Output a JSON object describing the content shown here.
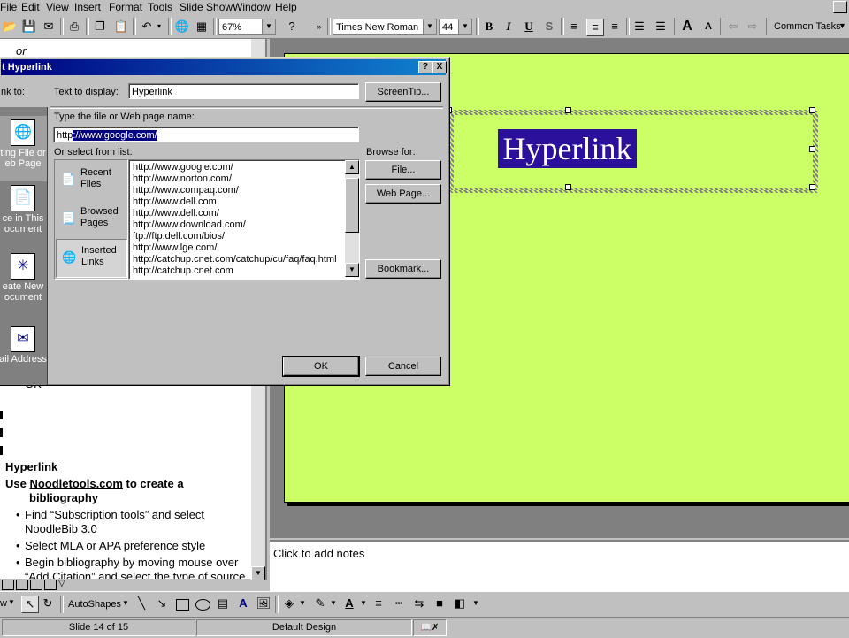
{
  "menubar": {
    "items": [
      "File",
      "Edit",
      "View",
      "Insert",
      "Format",
      "Tools",
      "Slide Show",
      "Window",
      "Help"
    ]
  },
  "toolbar": {
    "zoom": "67%",
    "font_name": "Times New Roman",
    "font_size": "44",
    "bold": "B",
    "italic": "I",
    "underline": "U",
    "shadow": "S",
    "common_tasks": "Common Tasks"
  },
  "outline": {
    "top_fragment": "or",
    "ok_fragment": "OK",
    "bullet_hyperlink": "Hyperlink",
    "bullet_use_prefix": "Use ",
    "bullet_use_link": "Noodletools.com",
    "bullet_use_suffix": " to create a",
    "bullet_use_line2": "bibliography",
    "sub1_line1": "Find “Subscription tools” and select",
    "sub1_line2": "NoodleBib 3.0",
    "sub2": "Select MLA or APA preference style",
    "sub3_line1": "Begin bibliography by moving mouse over",
    "sub3_line2": "“Add Citation” and select the type of source"
  },
  "slide": {
    "text": "Hyperlink",
    "notes_placeholder": "Click to add notes"
  },
  "dialog": {
    "title": "t Hyperlink",
    "help_btn": "?",
    "close_btn": "X",
    "link_to_label": "nk to:",
    "text_to_display_label": "Text to display:",
    "text_to_display_value": "Hyperlink",
    "screentip_label": "ScreenTip...",
    "file_web_label": "Type the file or Web page name:",
    "url_prefix": "http",
    "url_selected": "://www.google.com/",
    "select_from_list_label": "Or select from list:",
    "browse_for_label": "Browse for:",
    "file_btn": "File...",
    "webpage_btn": "Web Page...",
    "bookmark_btn": "Bookmark...",
    "ok_btn": "OK",
    "cancel_btn": "Cancel",
    "sidebar": [
      {
        "line1": "Recent",
        "line2": "Files"
      },
      {
        "line1": "Browsed",
        "line2": "Pages"
      },
      {
        "line1": "Inserted",
        "line2": "Links"
      }
    ],
    "link_targets": [
      {
        "line1": "ting File or",
        "line2": "eb Page"
      },
      {
        "line1": "ce in This",
        "line2": "ocument"
      },
      {
        "line1": "eate New",
        "line2": "ocument"
      },
      {
        "line1": "ail Address",
        "line2": ""
      }
    ],
    "links": [
      "http://www.google.com/",
      "http://www.norton.com/",
      "http://www.compaq.com/",
      "http://www.dell.com",
      "http://www.dell.com/",
      "http://www.download.com/",
      "ftp://ftp.dell.com/bios/",
      "http://www.lge.com/",
      "http://catchup.cnet.com/catchup/cu/faq/faq.html",
      "http://catchup.cnet.com"
    ]
  },
  "drawbar": {
    "draw": "w",
    "autoshapes": "AutoShapes"
  },
  "statusbar": {
    "slide": "Slide 14 of 15",
    "design": "Default Design"
  },
  "colors": {
    "slide_bg": "#ccff66",
    "selection": "#2a109a",
    "titlebar": "#000080"
  }
}
